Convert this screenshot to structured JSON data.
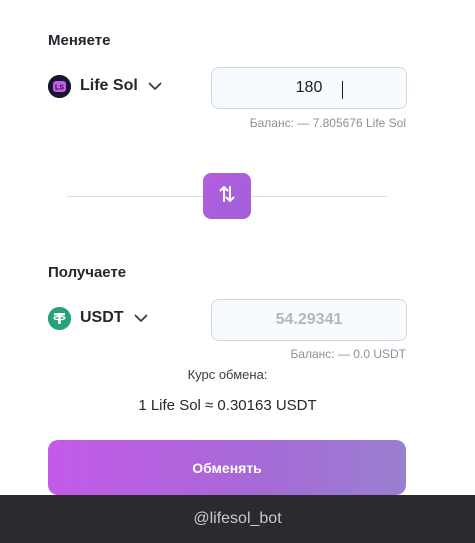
{
  "from": {
    "section_title": "Меняете",
    "token_name": "Life Sol",
    "token_logo_text": "LS",
    "amount": "180",
    "balance": "Баланс: — 7.805676 Life Sol"
  },
  "to": {
    "section_title": "Получаете",
    "token_name": "USDT",
    "amount": "54.29341",
    "balance": "Баланс: — 0.0 USDT"
  },
  "rate": {
    "label": "Курс обмена:",
    "value": "1 Life Sol ≈ 0.30163 USDT"
  },
  "exchange_button_label": "Обменять",
  "footer_text": "@lifesol_bot",
  "colors": {
    "accent_purple": "#b45ee0",
    "usdt_green": "#26a17b",
    "footer_bg": "#2a2b2e"
  }
}
